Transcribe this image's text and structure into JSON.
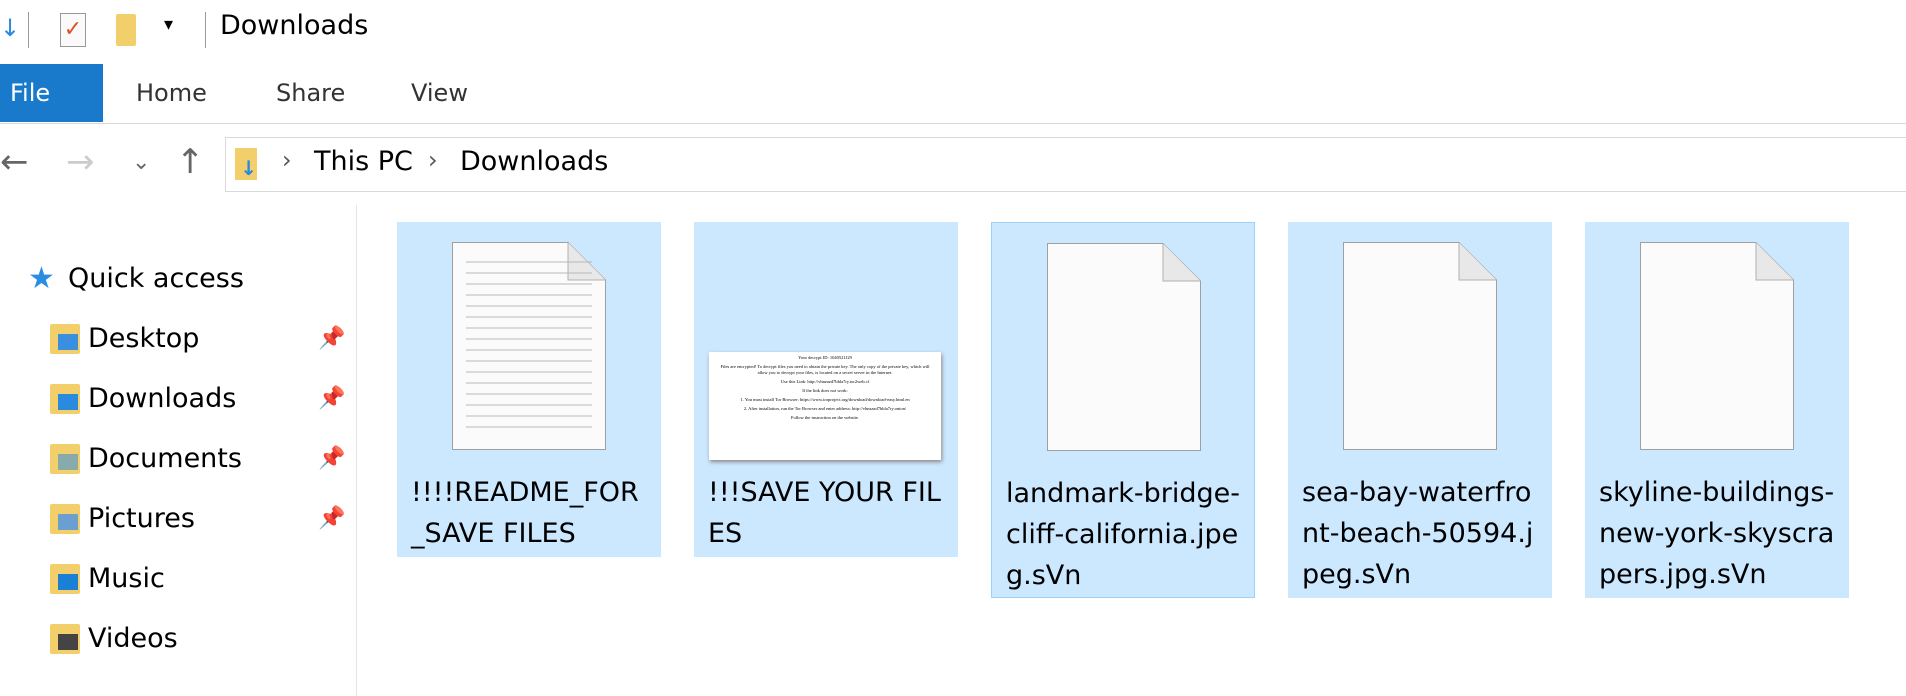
{
  "window": {
    "title": "Downloads"
  },
  "ribbon": {
    "tabs": [
      "File",
      "Home",
      "Share",
      "View"
    ]
  },
  "address": {
    "crumbs": [
      "This PC",
      "Downloads"
    ]
  },
  "sidebar": {
    "quick_access": "Quick access",
    "items": [
      {
        "label": "Desktop",
        "icon": "desktop-folder-icon",
        "pinned": true
      },
      {
        "label": "Downloads",
        "icon": "downloads-folder-icon",
        "pinned": true
      },
      {
        "label": "Documents",
        "icon": "documents-folder-icon",
        "pinned": true
      },
      {
        "label": "Pictures",
        "icon": "pictures-folder-icon",
        "pinned": true
      },
      {
        "label": "Music",
        "icon": "music-folder-icon",
        "pinned": false
      },
      {
        "label": "Videos",
        "icon": "videos-folder-icon",
        "pinned": false
      }
    ]
  },
  "files": [
    {
      "name": "!!!!README_FOR_SAVE FILES",
      "icon": "text-document-icon"
    },
    {
      "name": "!!!SAVE YOUR FILES",
      "icon": "html-thumbnail"
    },
    {
      "name": "landmark-bridge-cliff-california.jpeg.sVn",
      "icon": "blank-file-icon"
    },
    {
      "name": "sea-bay-waterfront-beach-50594.jpeg.sVn",
      "icon": "blank-file-icon"
    },
    {
      "name": "skyline-buildings-new-york-skyscrapers.jpg.sVn",
      "icon": "blank-file-icon"
    }
  ],
  "thumbnail_text": [
    "Your decrypt ID: 1040521J29",
    "Files are encrypted! To decrypt files you need to obtain the private key. The only copy of the private key, which will allow you to decrypt your files, is located on a secret server in the Internet.",
    "Use this Link: http://vhnzazd7bhla7ry.tor2web.cf",
    "If the link does not work:",
    "1. You must install Tor Browser: https://www.torproject.org/download/download-easy.html.en",
    "2. After installation, run the Tor Browser and enter address: http://vhnzazd7bhla7ry.onion/",
    "Follow the instruction on the website."
  ],
  "colors": {
    "accent": "#1979ca",
    "selection": "#cce8ff"
  }
}
